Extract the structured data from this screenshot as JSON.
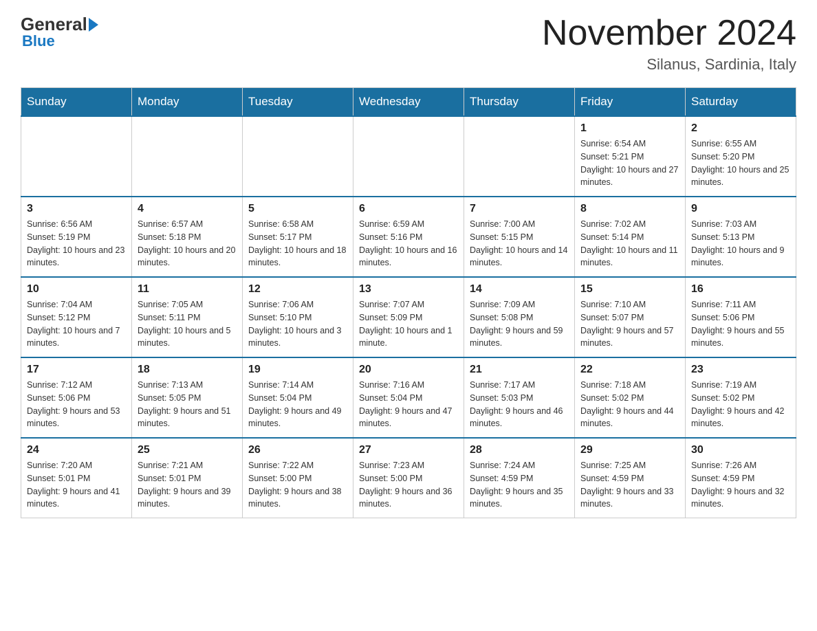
{
  "header": {
    "logo_general": "General",
    "logo_blue": "Blue",
    "main_title": "November 2024",
    "subtitle": "Silanus, Sardinia, Italy"
  },
  "days_of_week": [
    "Sunday",
    "Monday",
    "Tuesday",
    "Wednesday",
    "Thursday",
    "Friday",
    "Saturday"
  ],
  "weeks": [
    [
      {
        "day": "",
        "info": ""
      },
      {
        "day": "",
        "info": ""
      },
      {
        "day": "",
        "info": ""
      },
      {
        "day": "",
        "info": ""
      },
      {
        "day": "",
        "info": ""
      },
      {
        "day": "1",
        "info": "Sunrise: 6:54 AM\nSunset: 5:21 PM\nDaylight: 10 hours and 27 minutes."
      },
      {
        "day": "2",
        "info": "Sunrise: 6:55 AM\nSunset: 5:20 PM\nDaylight: 10 hours and 25 minutes."
      }
    ],
    [
      {
        "day": "3",
        "info": "Sunrise: 6:56 AM\nSunset: 5:19 PM\nDaylight: 10 hours and 23 minutes."
      },
      {
        "day": "4",
        "info": "Sunrise: 6:57 AM\nSunset: 5:18 PM\nDaylight: 10 hours and 20 minutes."
      },
      {
        "day": "5",
        "info": "Sunrise: 6:58 AM\nSunset: 5:17 PM\nDaylight: 10 hours and 18 minutes."
      },
      {
        "day": "6",
        "info": "Sunrise: 6:59 AM\nSunset: 5:16 PM\nDaylight: 10 hours and 16 minutes."
      },
      {
        "day": "7",
        "info": "Sunrise: 7:00 AM\nSunset: 5:15 PM\nDaylight: 10 hours and 14 minutes."
      },
      {
        "day": "8",
        "info": "Sunrise: 7:02 AM\nSunset: 5:14 PM\nDaylight: 10 hours and 11 minutes."
      },
      {
        "day": "9",
        "info": "Sunrise: 7:03 AM\nSunset: 5:13 PM\nDaylight: 10 hours and 9 minutes."
      }
    ],
    [
      {
        "day": "10",
        "info": "Sunrise: 7:04 AM\nSunset: 5:12 PM\nDaylight: 10 hours and 7 minutes."
      },
      {
        "day": "11",
        "info": "Sunrise: 7:05 AM\nSunset: 5:11 PM\nDaylight: 10 hours and 5 minutes."
      },
      {
        "day": "12",
        "info": "Sunrise: 7:06 AM\nSunset: 5:10 PM\nDaylight: 10 hours and 3 minutes."
      },
      {
        "day": "13",
        "info": "Sunrise: 7:07 AM\nSunset: 5:09 PM\nDaylight: 10 hours and 1 minute."
      },
      {
        "day": "14",
        "info": "Sunrise: 7:09 AM\nSunset: 5:08 PM\nDaylight: 9 hours and 59 minutes."
      },
      {
        "day": "15",
        "info": "Sunrise: 7:10 AM\nSunset: 5:07 PM\nDaylight: 9 hours and 57 minutes."
      },
      {
        "day": "16",
        "info": "Sunrise: 7:11 AM\nSunset: 5:06 PM\nDaylight: 9 hours and 55 minutes."
      }
    ],
    [
      {
        "day": "17",
        "info": "Sunrise: 7:12 AM\nSunset: 5:06 PM\nDaylight: 9 hours and 53 minutes."
      },
      {
        "day": "18",
        "info": "Sunrise: 7:13 AM\nSunset: 5:05 PM\nDaylight: 9 hours and 51 minutes."
      },
      {
        "day": "19",
        "info": "Sunrise: 7:14 AM\nSunset: 5:04 PM\nDaylight: 9 hours and 49 minutes."
      },
      {
        "day": "20",
        "info": "Sunrise: 7:16 AM\nSunset: 5:04 PM\nDaylight: 9 hours and 47 minutes."
      },
      {
        "day": "21",
        "info": "Sunrise: 7:17 AM\nSunset: 5:03 PM\nDaylight: 9 hours and 46 minutes."
      },
      {
        "day": "22",
        "info": "Sunrise: 7:18 AM\nSunset: 5:02 PM\nDaylight: 9 hours and 44 minutes."
      },
      {
        "day": "23",
        "info": "Sunrise: 7:19 AM\nSunset: 5:02 PM\nDaylight: 9 hours and 42 minutes."
      }
    ],
    [
      {
        "day": "24",
        "info": "Sunrise: 7:20 AM\nSunset: 5:01 PM\nDaylight: 9 hours and 41 minutes."
      },
      {
        "day": "25",
        "info": "Sunrise: 7:21 AM\nSunset: 5:01 PM\nDaylight: 9 hours and 39 minutes."
      },
      {
        "day": "26",
        "info": "Sunrise: 7:22 AM\nSunset: 5:00 PM\nDaylight: 9 hours and 38 minutes."
      },
      {
        "day": "27",
        "info": "Sunrise: 7:23 AM\nSunset: 5:00 PM\nDaylight: 9 hours and 36 minutes."
      },
      {
        "day": "28",
        "info": "Sunrise: 7:24 AM\nSunset: 4:59 PM\nDaylight: 9 hours and 35 minutes."
      },
      {
        "day": "29",
        "info": "Sunrise: 7:25 AM\nSunset: 4:59 PM\nDaylight: 9 hours and 33 minutes."
      },
      {
        "day": "30",
        "info": "Sunrise: 7:26 AM\nSunset: 4:59 PM\nDaylight: 9 hours and 32 minutes."
      }
    ]
  ]
}
